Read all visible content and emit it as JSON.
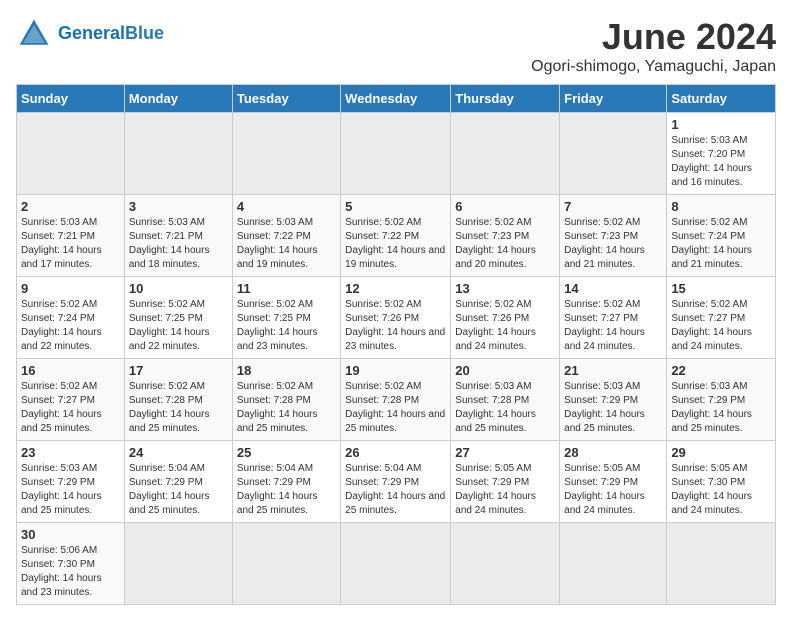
{
  "header": {
    "logo_general": "General",
    "logo_blue": "Blue",
    "main_title": "June 2024",
    "subtitle": "Ogori-shimogo, Yamaguchi, Japan"
  },
  "days_of_week": [
    "Sunday",
    "Monday",
    "Tuesday",
    "Wednesday",
    "Thursday",
    "Friday",
    "Saturday"
  ],
  "weeks": [
    [
      {
        "day": "",
        "info": ""
      },
      {
        "day": "",
        "info": ""
      },
      {
        "day": "",
        "info": ""
      },
      {
        "day": "",
        "info": ""
      },
      {
        "day": "",
        "info": ""
      },
      {
        "day": "",
        "info": ""
      },
      {
        "day": "1",
        "info": "Sunrise: 5:03 AM\nSunset: 7:20 PM\nDaylight: 14 hours and 16 minutes."
      }
    ],
    [
      {
        "day": "2",
        "info": "Sunrise: 5:03 AM\nSunset: 7:21 PM\nDaylight: 14 hours and 17 minutes."
      },
      {
        "day": "3",
        "info": "Sunrise: 5:03 AM\nSunset: 7:21 PM\nDaylight: 14 hours and 18 minutes."
      },
      {
        "day": "4",
        "info": "Sunrise: 5:03 AM\nSunset: 7:22 PM\nDaylight: 14 hours and 19 minutes."
      },
      {
        "day": "5",
        "info": "Sunrise: 5:02 AM\nSunset: 7:22 PM\nDaylight: 14 hours and 19 minutes."
      },
      {
        "day": "6",
        "info": "Sunrise: 5:02 AM\nSunset: 7:23 PM\nDaylight: 14 hours and 20 minutes."
      },
      {
        "day": "7",
        "info": "Sunrise: 5:02 AM\nSunset: 7:23 PM\nDaylight: 14 hours and 21 minutes."
      },
      {
        "day": "8",
        "info": "Sunrise: 5:02 AM\nSunset: 7:24 PM\nDaylight: 14 hours and 21 minutes."
      }
    ],
    [
      {
        "day": "9",
        "info": "Sunrise: 5:02 AM\nSunset: 7:24 PM\nDaylight: 14 hours and 22 minutes."
      },
      {
        "day": "10",
        "info": "Sunrise: 5:02 AM\nSunset: 7:25 PM\nDaylight: 14 hours and 22 minutes."
      },
      {
        "day": "11",
        "info": "Sunrise: 5:02 AM\nSunset: 7:25 PM\nDaylight: 14 hours and 23 minutes."
      },
      {
        "day": "12",
        "info": "Sunrise: 5:02 AM\nSunset: 7:26 PM\nDaylight: 14 hours and 23 minutes."
      },
      {
        "day": "13",
        "info": "Sunrise: 5:02 AM\nSunset: 7:26 PM\nDaylight: 14 hours and 24 minutes."
      },
      {
        "day": "14",
        "info": "Sunrise: 5:02 AM\nSunset: 7:27 PM\nDaylight: 14 hours and 24 minutes."
      },
      {
        "day": "15",
        "info": "Sunrise: 5:02 AM\nSunset: 7:27 PM\nDaylight: 14 hours and 24 minutes."
      }
    ],
    [
      {
        "day": "16",
        "info": "Sunrise: 5:02 AM\nSunset: 7:27 PM\nDaylight: 14 hours and 25 minutes."
      },
      {
        "day": "17",
        "info": "Sunrise: 5:02 AM\nSunset: 7:28 PM\nDaylight: 14 hours and 25 minutes."
      },
      {
        "day": "18",
        "info": "Sunrise: 5:02 AM\nSunset: 7:28 PM\nDaylight: 14 hours and 25 minutes."
      },
      {
        "day": "19",
        "info": "Sunrise: 5:02 AM\nSunset: 7:28 PM\nDaylight: 14 hours and 25 minutes."
      },
      {
        "day": "20",
        "info": "Sunrise: 5:03 AM\nSunset: 7:28 PM\nDaylight: 14 hours and 25 minutes."
      },
      {
        "day": "21",
        "info": "Sunrise: 5:03 AM\nSunset: 7:29 PM\nDaylight: 14 hours and 25 minutes."
      },
      {
        "day": "22",
        "info": "Sunrise: 5:03 AM\nSunset: 7:29 PM\nDaylight: 14 hours and 25 minutes."
      }
    ],
    [
      {
        "day": "23",
        "info": "Sunrise: 5:03 AM\nSunset: 7:29 PM\nDaylight: 14 hours and 25 minutes."
      },
      {
        "day": "24",
        "info": "Sunrise: 5:04 AM\nSunset: 7:29 PM\nDaylight: 14 hours and 25 minutes."
      },
      {
        "day": "25",
        "info": "Sunrise: 5:04 AM\nSunset: 7:29 PM\nDaylight: 14 hours and 25 minutes."
      },
      {
        "day": "26",
        "info": "Sunrise: 5:04 AM\nSunset: 7:29 PM\nDaylight: 14 hours and 25 minutes."
      },
      {
        "day": "27",
        "info": "Sunrise: 5:05 AM\nSunset: 7:29 PM\nDaylight: 14 hours and 24 minutes."
      },
      {
        "day": "28",
        "info": "Sunrise: 5:05 AM\nSunset: 7:29 PM\nDaylight: 14 hours and 24 minutes."
      },
      {
        "day": "29",
        "info": "Sunrise: 5:05 AM\nSunset: 7:30 PM\nDaylight: 14 hours and 24 minutes."
      }
    ],
    [
      {
        "day": "30",
        "info": "Sunrise: 5:06 AM\nSunset: 7:30 PM\nDaylight: 14 hours and 23 minutes."
      },
      {
        "day": "",
        "info": ""
      },
      {
        "day": "",
        "info": ""
      },
      {
        "day": "",
        "info": ""
      },
      {
        "day": "",
        "info": ""
      },
      {
        "day": "",
        "info": ""
      },
      {
        "day": "",
        "info": ""
      }
    ]
  ]
}
